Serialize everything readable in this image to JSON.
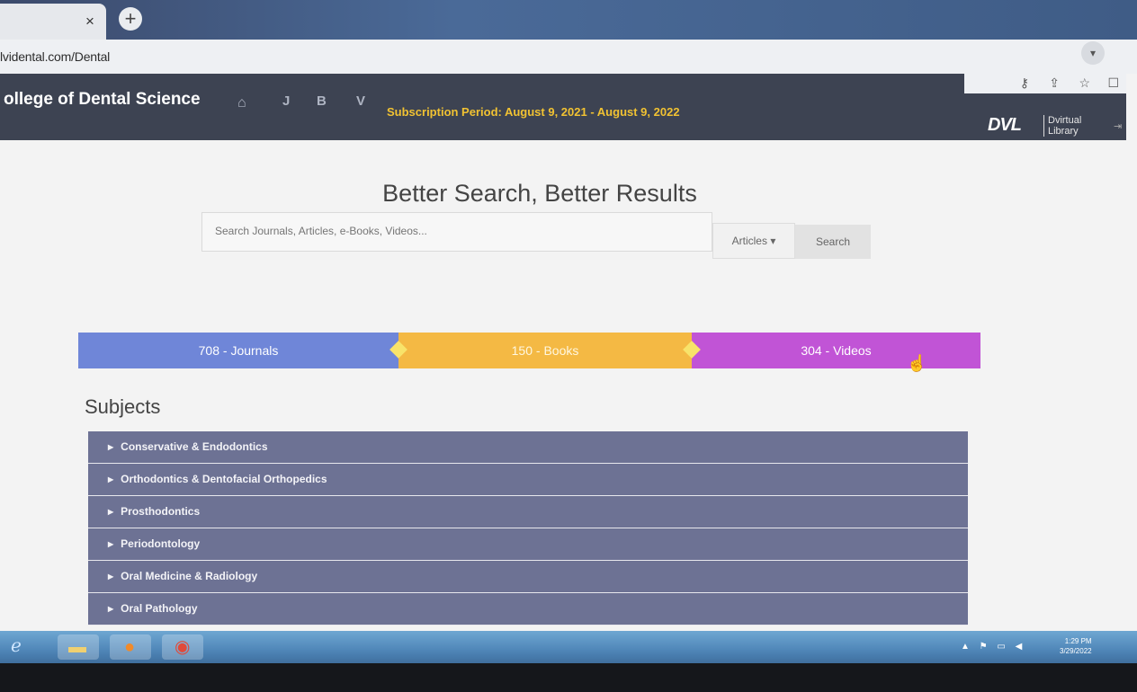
{
  "browser": {
    "tab_close": "×",
    "new_tab": "+",
    "url": "lvidental.com/Dental",
    "icons": [
      "key-icon",
      "share-icon",
      "star-icon",
      "tab-icon"
    ]
  },
  "header": {
    "college": "ollege of Dental Science",
    "nav": [
      "J",
      "B",
      "V"
    ],
    "subscription": "Subscription Period: August 9, 2021 - August 9, 2022",
    "logo_main": "DVL",
    "logo_sub_line1": "Dvirtual",
    "logo_sub_line2": "Library"
  },
  "search": {
    "headline": "Better Search, Better Results",
    "placeholder": "Search Journals, Articles, e-Books, Videos...",
    "filter": "Articles ▾",
    "button": "Search"
  },
  "stats": {
    "journals": "708 - Journals",
    "books": "150 - Books",
    "videos": "304 - Videos"
  },
  "subjects": {
    "title": "Subjects",
    "items": [
      "Conservative & Endodontics",
      "Orthodontics & Dentofacial Orthopedics",
      "Prosthodontics",
      "Periodontology",
      "Oral Medicine & Radiology",
      "Oral Pathology"
    ]
  },
  "taskbar": {
    "time": "1:29 PM",
    "date": "3/29/2022"
  },
  "colors": {
    "navbar": "#3d4352",
    "subscription": "#f1c232",
    "journals": "#6f86d8",
    "books": "#f4b944",
    "videos": "#c154d6",
    "subject_row": "#6d7294"
  }
}
